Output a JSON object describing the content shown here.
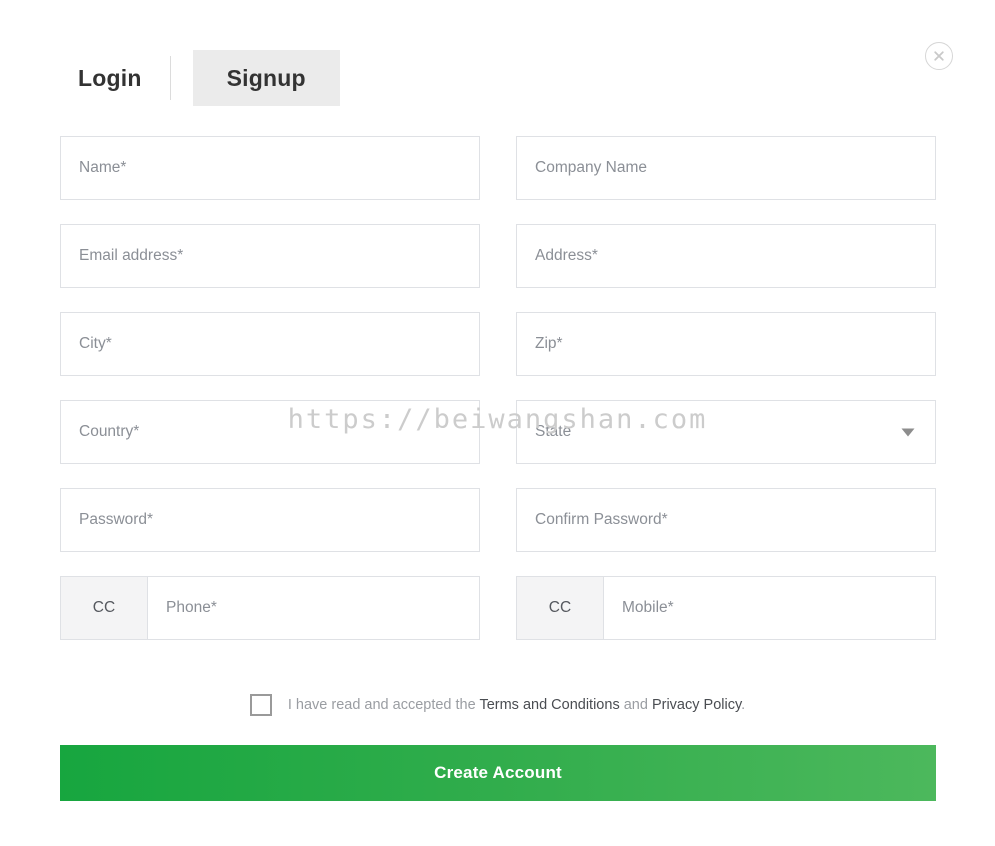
{
  "tabs": {
    "login_label": "Login",
    "signup_label": "Signup"
  },
  "close": {
    "icon": "close-icon"
  },
  "form": {
    "rows": [
      {
        "left": {
          "placeholder": "Name*",
          "type": "text"
        },
        "right": {
          "placeholder": "Company Name",
          "type": "text"
        }
      },
      {
        "left": {
          "placeholder": "Email address*",
          "type": "text"
        },
        "right": {
          "placeholder": "Address*",
          "type": "text"
        }
      },
      {
        "left": {
          "placeholder": "City*",
          "type": "text"
        },
        "right": {
          "placeholder": "Zip*",
          "type": "text"
        }
      },
      {
        "left": {
          "placeholder": "Country*",
          "type": "select"
        },
        "right": {
          "placeholder": "State",
          "type": "select"
        }
      },
      {
        "left": {
          "placeholder": "Password*",
          "type": "password"
        },
        "right": {
          "placeholder": "Confirm Password*",
          "type": "password"
        }
      }
    ],
    "phone": {
      "cc_label": "CC",
      "placeholder": "Phone*"
    },
    "mobile": {
      "cc_label": "CC",
      "placeholder": "Mobile*"
    }
  },
  "terms": {
    "checked": false,
    "prefix": "I have read and accepted the ",
    "terms_link": "Terms and Conditions",
    "conjunction": " and ",
    "privacy_link": "Privacy Policy",
    "suffix": "."
  },
  "submit": {
    "label": "Create Account",
    "color_left": "#17a63f",
    "color_right": "#4cb85c"
  },
  "watermark": {
    "text": "https://beiwangshan.com"
  }
}
